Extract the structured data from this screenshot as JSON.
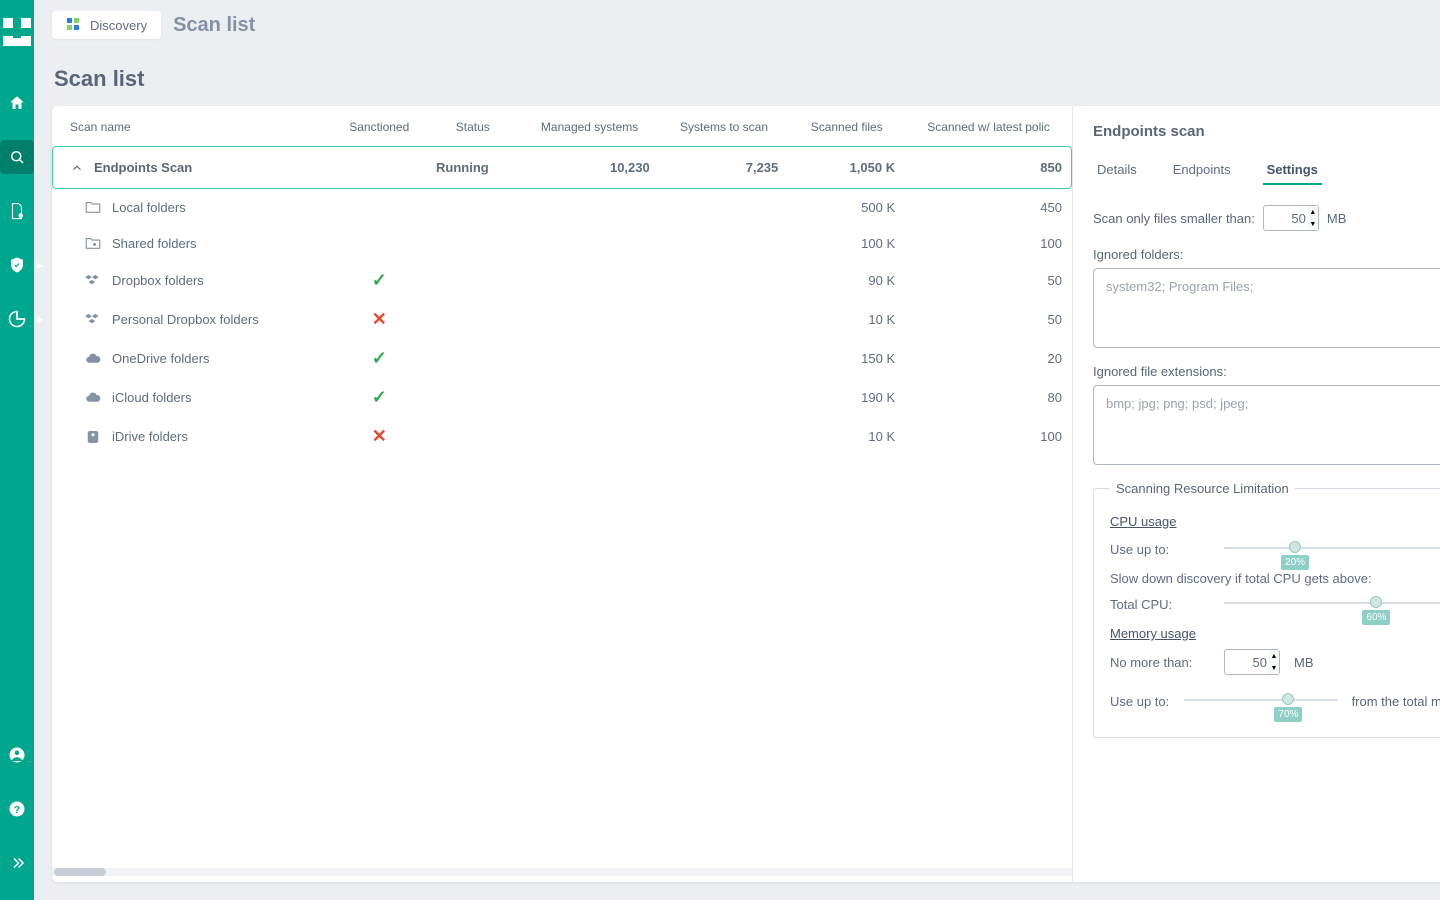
{
  "app": {
    "breadcrumb_label": "Discovery",
    "top_title": "Scan list",
    "page_title": "Scan list"
  },
  "nav": {
    "items": [
      "home",
      "search",
      "document",
      "shield",
      "chart"
    ],
    "bottom": [
      "user",
      "help",
      "expand"
    ]
  },
  "table": {
    "columns": [
      "Scan name",
      "Sanctioned",
      "Status",
      "Managed systems",
      "Systems to scan",
      "Scanned files",
      "Scanned w/ latest polic"
    ],
    "parent": {
      "name": "Endpoints Scan",
      "sanctioned": "",
      "status": "Running",
      "managed_systems": "10,230",
      "systems_to_scan": "7,235",
      "scanned_files": "1,050 K",
      "scanned_latest": "850"
    },
    "children": [
      {
        "icon": "folder",
        "name": "Local folders",
        "sanctioned": null,
        "scanned_files": "500 K",
        "scanned_latest": "450"
      },
      {
        "icon": "folder-shared",
        "name": "Shared folders",
        "sanctioned": null,
        "scanned_files": "100 K",
        "scanned_latest": "100"
      },
      {
        "icon": "dropbox",
        "name": "Dropbox folders",
        "sanctioned": true,
        "scanned_files": "90 K",
        "scanned_latest": "50"
      },
      {
        "icon": "dropbox",
        "name": "Personal Dropbox folders",
        "sanctioned": false,
        "scanned_files": "10 K",
        "scanned_latest": "50"
      },
      {
        "icon": "cloud",
        "name": "OneDrive folders",
        "sanctioned": true,
        "scanned_files": "150 K",
        "scanned_latest": "20"
      },
      {
        "icon": "cloud",
        "name": "iCloud folders",
        "sanctioned": true,
        "scanned_files": "190 K",
        "scanned_latest": "80"
      },
      {
        "icon": "drive",
        "name": "iDrive folders",
        "sanctioned": false,
        "scanned_files": "10 K",
        "scanned_latest": "100"
      }
    ]
  },
  "panel": {
    "title": "Endpoints scan",
    "tabs": [
      "Details",
      "Endpoints",
      "Settings"
    ],
    "active_tab": 2,
    "settings": {
      "file_size_label": "Scan only files smaller than:",
      "file_size_value": "50",
      "file_size_unit": "MB",
      "ignored_folders_label": "Ignored folders:",
      "ignored_folders_value": "system32; Program Files;",
      "ignored_ext_label": "Ignored file extensions:",
      "ignored_ext_value": "bmp; jpg; png; psd; jpeg;",
      "resource_limit_legend": "Scanning Resource Limitation",
      "cpu_subhead": "CPU usage",
      "cpu_use_up_to_label": "Use up to:",
      "cpu_use_up_to_value": "20%",
      "cpu_slow_label": "Slow down discovery if total CPU gets above:",
      "cpu_total_label": "Total CPU:",
      "cpu_total_value": "60%",
      "mem_subhead": "Memory usage",
      "mem_no_more_label": "No more than:",
      "mem_no_more_value": "50",
      "mem_no_more_unit": "MB",
      "mem_use_up_to_label": "Use up to:",
      "mem_use_up_to_value": "70%",
      "mem_use_up_to_suffix": "from the total memory"
    }
  }
}
